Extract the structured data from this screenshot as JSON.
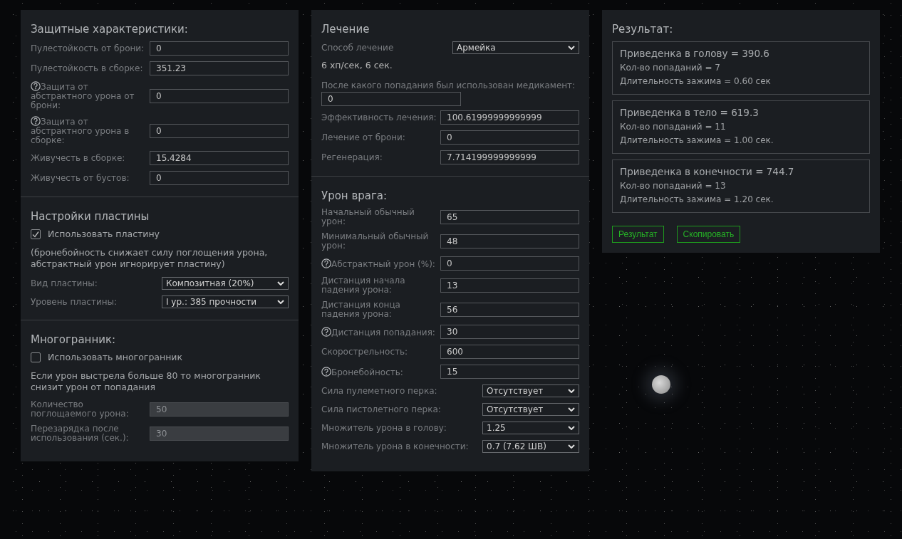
{
  "columns": [
    {
      "sections": [
        {
          "title": "Защитные характеристики:",
          "rows": [
            {
              "kind": "field",
              "label": "Пулестойкость от брони:",
              "value": "0",
              "help": false,
              "disabled": false
            },
            {
              "kind": "field",
              "label": "Пулестойкость в сборке:",
              "value": "351.23",
              "help": false,
              "disabled": false
            },
            {
              "kind": "field",
              "label": "Защита от абстрактного урона от брони:",
              "value": "0",
              "help": true,
              "disabled": false
            },
            {
              "kind": "field",
              "label": "Защита от абстрактного урона в сборке:",
              "value": "0",
              "help": true,
              "disabled": false
            },
            {
              "kind": "field",
              "label": "Живучесть в сборке:",
              "value": "15.4284",
              "help": false,
              "disabled": false
            },
            {
              "kind": "field",
              "label": "Живучесть от бустов:",
              "value": "0",
              "help": false,
              "disabled": false
            }
          ]
        },
        {
          "title": "Настройки пластины",
          "rows": [
            {
              "kind": "checkbox",
              "label": "Использовать пластину",
              "checked": true
            },
            {
              "kind": "note",
              "text": "(бронебойность снижает силу поглощения урона, абстрактный урон игнорирует пластину)"
            },
            {
              "kind": "select",
              "label": "Вид пластины:",
              "value": "Композитная (20%)"
            },
            {
              "kind": "select",
              "label": "Уровень пластины:",
              "value": "I ур.: 385 прочности"
            }
          ]
        },
        {
          "title": "Многогранник:",
          "rows": [
            {
              "kind": "checkbox",
              "label": "Использовать многогранник",
              "checked": false
            },
            {
              "kind": "note",
              "text": "Если урон выстрела больше 80 то многогранник снизит урон от попадания"
            },
            {
              "kind": "field",
              "label": "Количество поглощаемого урона:",
              "value": "50",
              "help": false,
              "disabled": true
            },
            {
              "kind": "field",
              "label": "Перезарядка после использования (сек.):",
              "value": "30",
              "help": false,
              "disabled": true
            }
          ]
        }
      ]
    },
    {
      "sections": [
        {
          "title": "Лечение",
          "rows": [
            {
              "kind": "select",
              "label": "Способ лечение",
              "value": "Армейка"
            },
            {
              "kind": "note",
              "text": "6 хп/сек, 6 сек."
            },
            {
              "kind": "stacked_field",
              "label": "После какого попадания был использован медикамент:",
              "value": "0"
            },
            {
              "kind": "field",
              "label": "Эффективность лечения:",
              "value": "100.61999999999999",
              "help": false,
              "disabled": false
            },
            {
              "kind": "field",
              "label": "Лечение от брони:",
              "value": "0",
              "help": false,
              "disabled": false
            },
            {
              "kind": "field",
              "label": "Регенерация:",
              "value": "7.714199999999999",
              "help": false,
              "disabled": false
            }
          ]
        },
        {
          "title": "Урон врага:",
          "rows": [
            {
              "kind": "field",
              "label": "Начальный обычный урон:",
              "value": "65",
              "help": false,
              "disabled": false
            },
            {
              "kind": "field",
              "label": "Минимальный обычный урон:",
              "value": "48",
              "help": false,
              "disabled": false
            },
            {
              "kind": "field",
              "label": "Абстрактный урон (%):",
              "value": "0",
              "help": true,
              "disabled": false
            },
            {
              "kind": "field",
              "label": "Дистанция начала падения урона:",
              "value": "13",
              "help": false,
              "disabled": false
            },
            {
              "kind": "field",
              "label": "Дистанция конца падения урона:",
              "value": "56",
              "help": false,
              "disabled": false
            },
            {
              "kind": "field",
              "label": "Дистанция попадания:",
              "value": "30",
              "help": true,
              "disabled": false
            },
            {
              "kind": "field",
              "label": "Скорострельность:",
              "value": "600",
              "help": false,
              "disabled": false
            },
            {
              "kind": "field",
              "label": "Бронебойность:",
              "value": "15",
              "help": true,
              "disabled": false
            },
            {
              "kind": "select",
              "label": "Сила пулеметного перка:",
              "value": "Отсутствует"
            },
            {
              "kind": "select",
              "label": "Сила пистолетного перка:",
              "value": "Отсутствует"
            },
            {
              "kind": "select",
              "label": "Множитель урона в голову:",
              "value": "1.25"
            },
            {
              "kind": "select",
              "label": "Множитель урона в конечности:",
              "value": "0.7 (7.62 ШВ)"
            }
          ]
        }
      ]
    }
  ],
  "result": {
    "title": "Результат:",
    "cards": [
      {
        "title": "Приведенка в голову = 390.6",
        "hits": "Кол-во попаданий = 7",
        "duration": "Длительность зажима = 0.60 сек"
      },
      {
        "title": "Приведенка в тело = 619.3",
        "hits": "Кол-во попаданий = 11",
        "duration": "Длительность зажима = 1.00 сек."
      },
      {
        "title": "Приведенка в конечности = 744.7",
        "hits": "Кол-во попаданий = 13",
        "duration": "Длительность зажима = 1.20 сек."
      }
    ],
    "buttons": [
      "Результат",
      "Скопировать"
    ]
  }
}
